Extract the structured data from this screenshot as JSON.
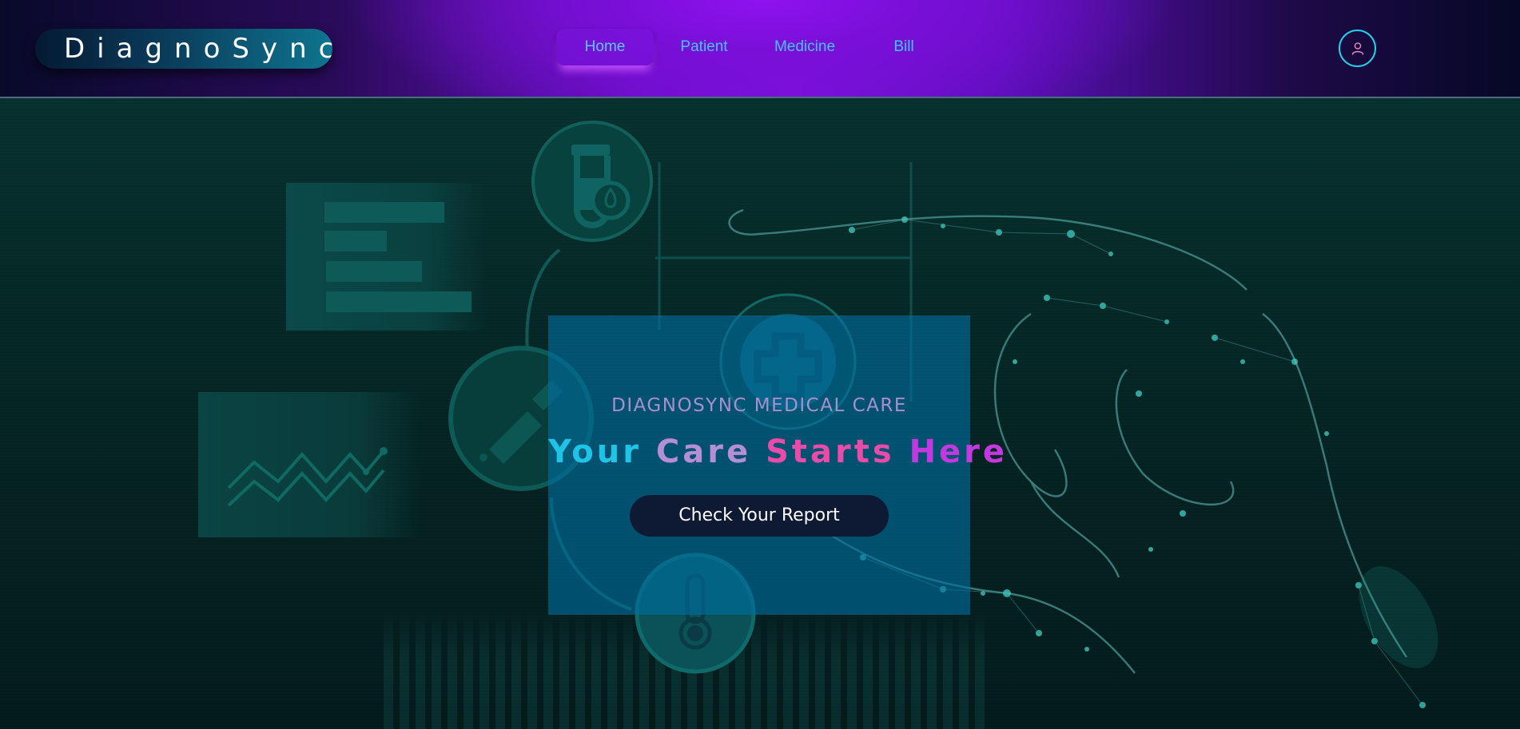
{
  "app": {
    "logo_text": "DiagnoSync"
  },
  "nav": {
    "items": [
      {
        "label": "Home",
        "active": true
      },
      {
        "label": "Patient",
        "active": false
      },
      {
        "label": "Medicine",
        "active": false
      },
      {
        "label": "Bill",
        "active": false
      }
    ],
    "profile_icon": "user-icon"
  },
  "hero": {
    "subtitle": "DIAGNOSYNC MEDICAL CARE",
    "headline": [
      "Your",
      "Care",
      "Starts",
      "Here"
    ],
    "button_label": "Check Your Report",
    "background_icons": [
      "test-tube-icon",
      "dropper-icon",
      "medical-cross-icon",
      "thermometer-icon",
      "document-icon",
      "chart-icon",
      "digital-hand-graphic"
    ]
  },
  "colors": {
    "accent_cyan": "#21d3ea",
    "nav_link": "#3fc6ff",
    "headline_pink": "#ea4aa8",
    "headline_purple": "#c23adf",
    "card_bg": "#006ea0",
    "button_bg": "#0e1a34"
  }
}
